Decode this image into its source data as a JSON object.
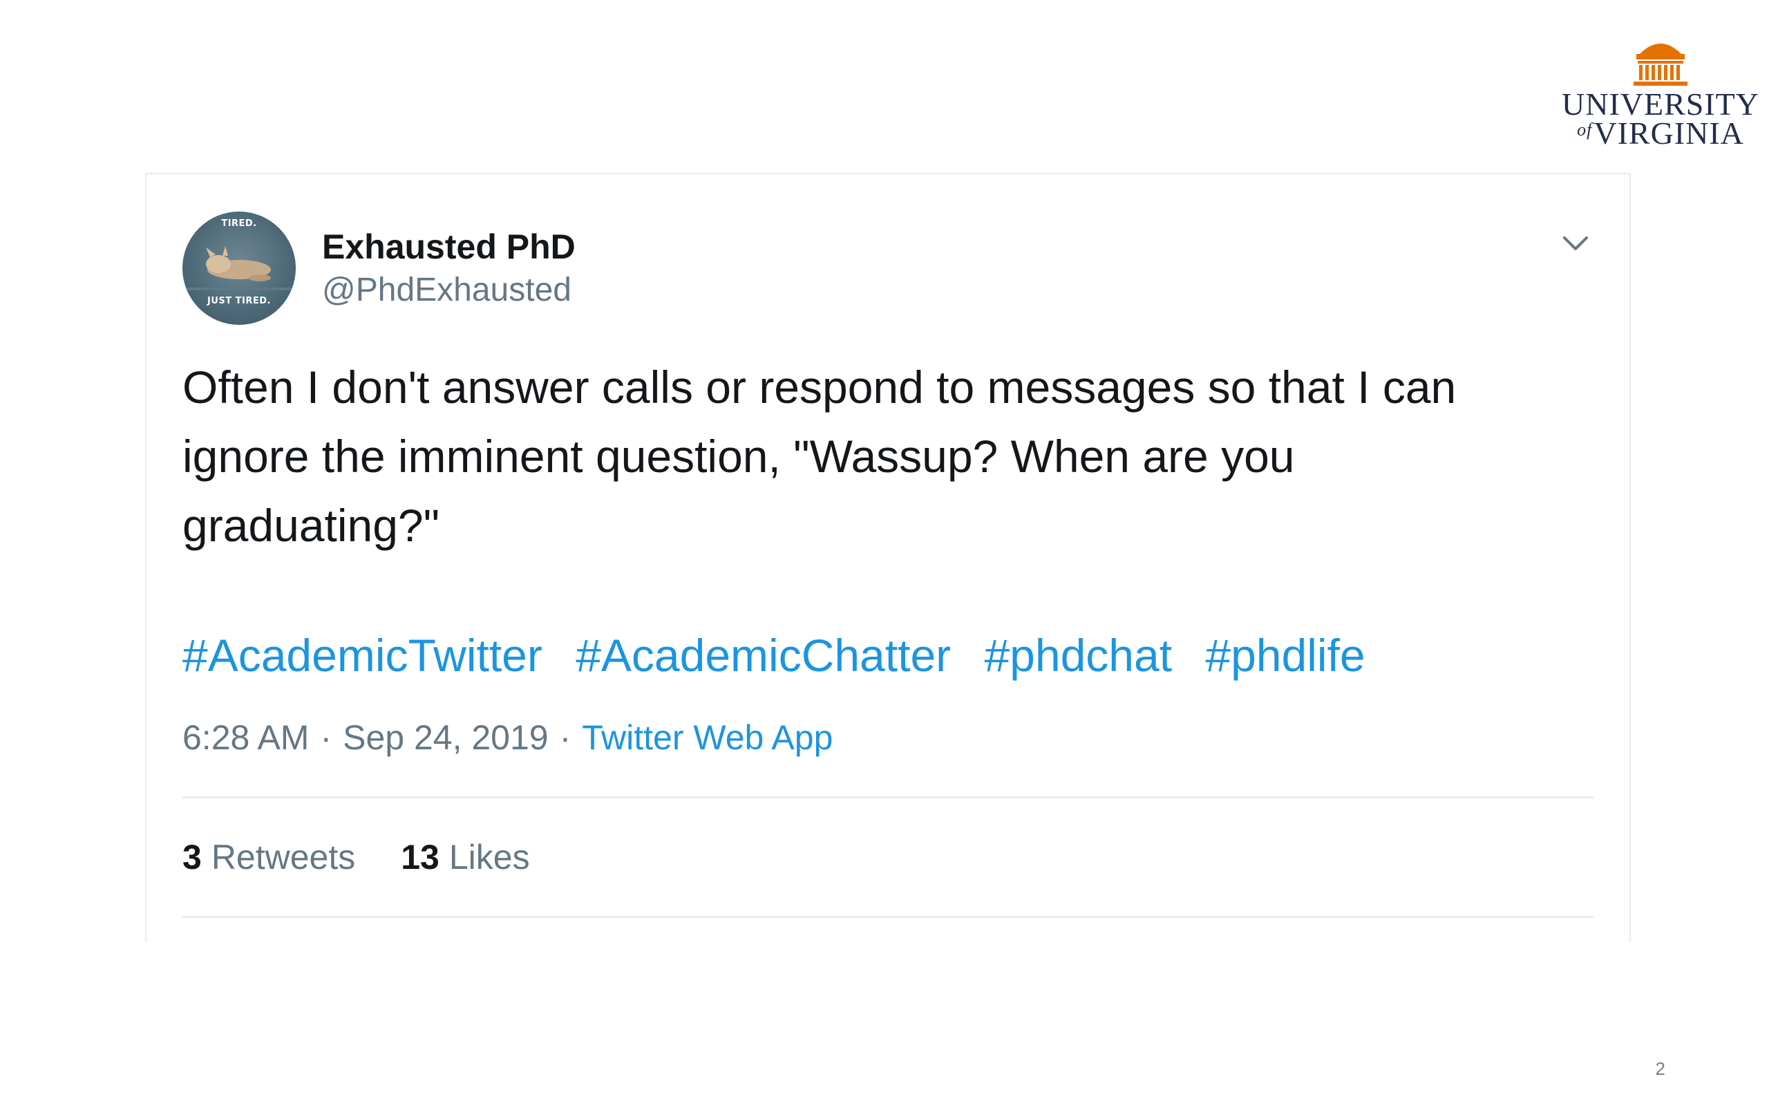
{
  "logo": {
    "line1": "UNIVERSITY",
    "of": "of",
    "line2": "VIRGINIA",
    "colors": {
      "navy": "#232d4b",
      "orange": "#e57200"
    }
  },
  "tweet": {
    "avatar": {
      "top_text": "TIRED.",
      "bottom_text": "JUST TIRED."
    },
    "display_name": "Exhausted PhD",
    "handle": "@PhdExhausted",
    "more_icon": "chevron-down-icon",
    "text": "Often I don't answer calls or respond to messages so that I can\nignore the imminent question, \"Wassup? When are you\ngraduating?\"",
    "hashtags": [
      "#AcademicTwitter",
      "#AcademicChatter",
      "#phdchat",
      "#phdlife"
    ],
    "time": "6:28 AM",
    "date": "Sep 24, 2019",
    "separator": "·",
    "source": "Twitter Web App",
    "stats": {
      "retweets_count": "3",
      "retweets_label": "Retweets",
      "likes_count": "13",
      "likes_label": "Likes"
    },
    "colors": {
      "link": "#1b95e0",
      "secondary": "#657786",
      "text": "#14171a"
    }
  },
  "slide": {
    "page_number": "2"
  }
}
